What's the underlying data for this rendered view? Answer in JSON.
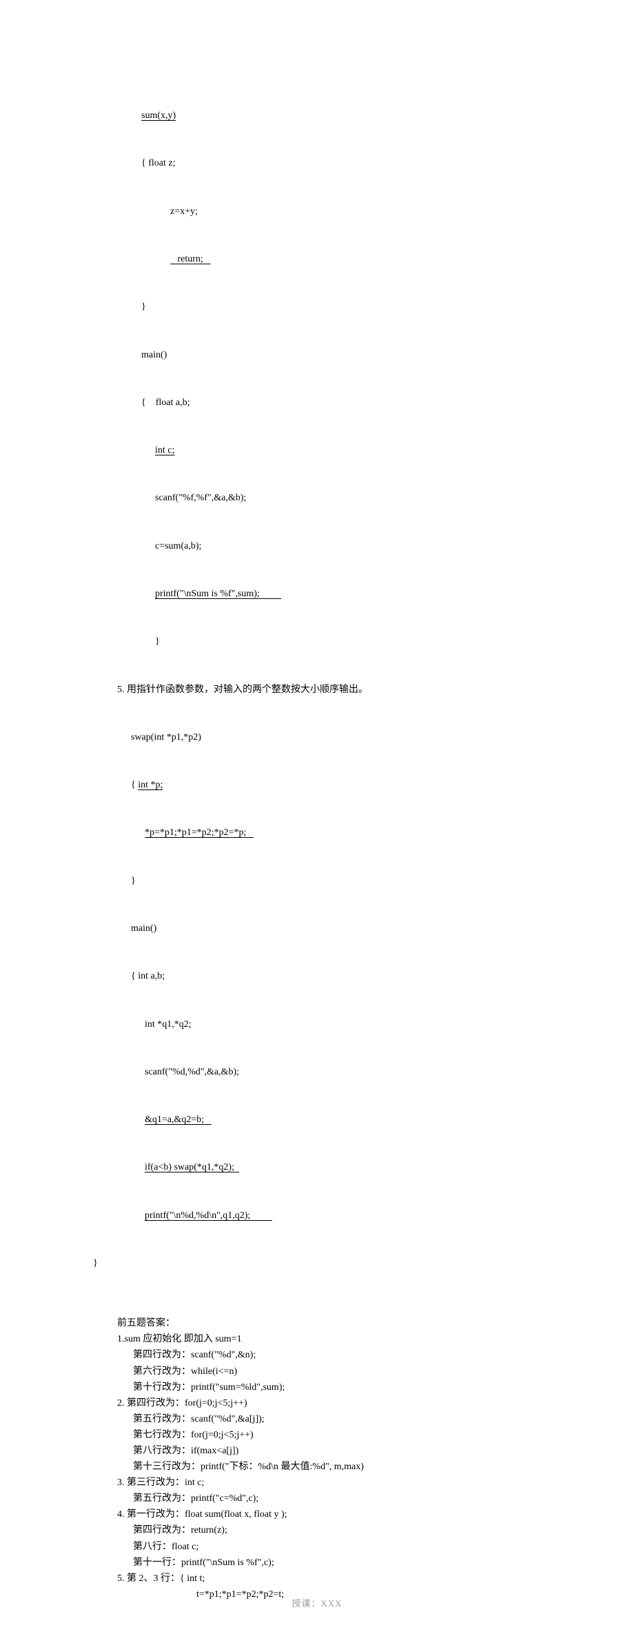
{
  "code4": {
    "l1": "sum(x,y)",
    "l2": "{ float z;",
    "l3": "z=x+y;",
    "l4": "return;",
    "l5": "}",
    "l6": "main()",
    "l7": "{    float a,b;",
    "l8": "int c;",
    "l9": "scanf(\"%f,%f\",&a,&b);",
    "l10": "c=sum(a,b);",
    "l11": "printf(\"\\nSum is %f\",sum);",
    "l12": "}"
  },
  "q5": {
    "title": "5.  用指针作函数参数，对输入的两个整数按大小顺序输出。",
    "l1": "swap(int *p1,*p2)",
    "l2": "{ int *p;",
    "l3": "*p=*p1;*p1=*p2;*p2=*p;",
    "l4": "}",
    "l5": "main()",
    "l6": "{ int a,b;",
    "l7": "int *q1,*q2;",
    "l8": "scanf(\"%d,%d\",&a,&b);",
    "l9": "&q1=a,&q2=b;",
    "l10": "if(a<b) swap(*q1,*q2);",
    "l11": "printf(\"\\n%d,%d\\n\",q1,q2);",
    "l12": "}"
  },
  "answers": {
    "header": "前五题答案：",
    "a1_1": "1.sum 应初始化  即加入 sum=1",
    "a1_2": "第四行改为：scanf(\"%d\",&n);",
    "a1_3": "第六行改为：while(i<=n)",
    "a1_4": "第十行改为：printf(\"sum=%ld\",sum);",
    "a2_1": "2.  第四行改为：for(j=0;j<5;j++)",
    "a2_2": "第五行改为：scanf(\"%d\",&a[j]);",
    "a2_3": "第七行改为：for(j=0;j<5;j++)",
    "a2_4": "第八行改为：if(max<a[j])",
    "a2_5": "第十三行改为：printf(\"下标：%d\\n 最大值:%d\", m,max)",
    "a3_1": "3.  第三行改为：int c;",
    "a3_2": "第五行改为：printf(\"c=%d\",c);",
    "a4_1": "4.  第一行改为：float sum(float x, float y );",
    "a4_2": "第四行改为：return(z);",
    "a4_3": "第八行：float c;",
    "a4_4": "第十一行：printf(\"\\nSum is %f\",c);",
    "a5_1": "5.  第 2、3 行：{ int t;",
    "a5_2": "t=*p1;*p1=*p2;*p2=t;"
  },
  "footer": "授课：XXX"
}
